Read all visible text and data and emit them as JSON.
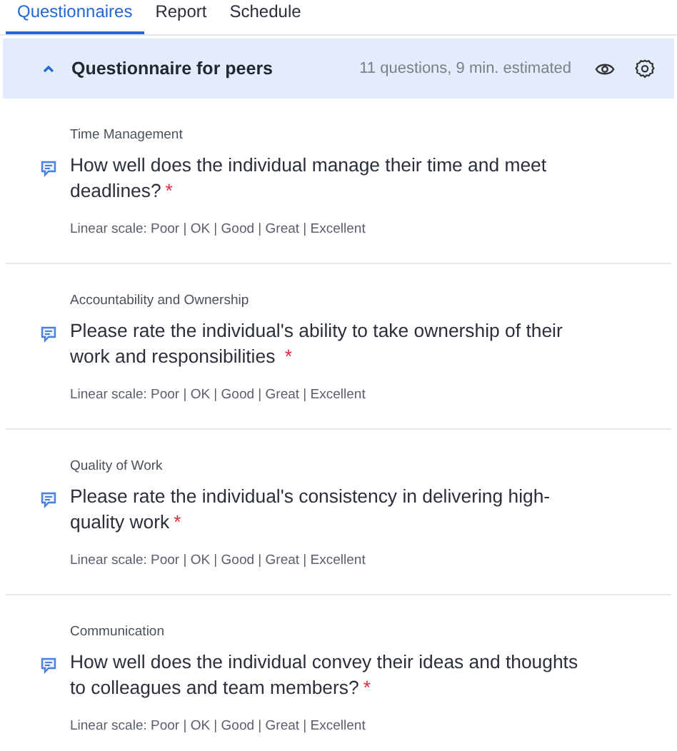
{
  "tabs": [
    {
      "label": "Questionnaires",
      "selected": true
    },
    {
      "label": "Report",
      "selected": false
    },
    {
      "label": "Schedule",
      "selected": false
    }
  ],
  "questionnaire": {
    "title": "Questionnaire for peers",
    "expanded": true,
    "summary": "11 questions, 9 min. estimated"
  },
  "questions": [
    {
      "category": "Time Management",
      "text": "How well does the individual manage their time and meet deadlines?",
      "required_mark": "*",
      "scale": "Linear scale: Poor | OK | Good | Great | Excellent"
    },
    {
      "category": "Accountability and Ownership",
      "text": "Please rate the individual's ability to take ownership of their work and responsibilities ",
      "required_mark": "*",
      "scale": "Linear scale: Poor | OK | Good | Great | Excellent"
    },
    {
      "category": "Quality of Work",
      "text": "Please rate the individual's consistency in delivering high-quality work",
      "required_mark": "*",
      "scale": "Linear scale: Poor | OK | Good | Great | Excellent"
    },
    {
      "category": "Communication",
      "text": "How well does the individual convey their ideas and thoughts to colleagues and team members?",
      "required_mark": "*",
      "scale": "Linear scale: Poor | OK | Good | Great | Excellent"
    }
  ]
}
